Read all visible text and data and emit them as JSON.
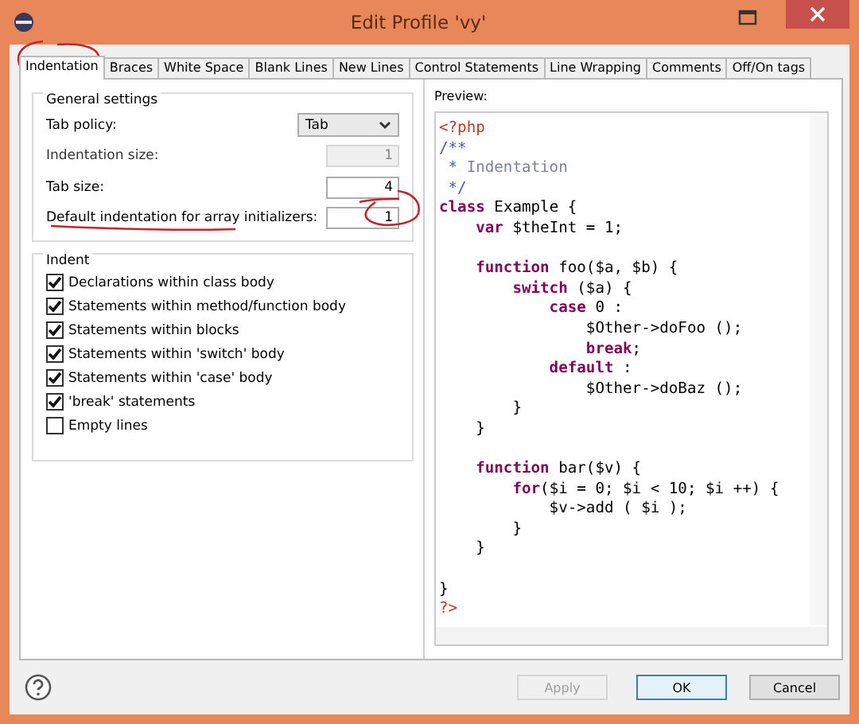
{
  "window": {
    "title": "Edit Profile 'vy'"
  },
  "tabs": [
    {
      "label": "Indentation",
      "selected": true
    },
    {
      "label": "Braces",
      "selected": false
    },
    {
      "label": "White Space",
      "selected": false
    },
    {
      "label": "Blank Lines",
      "selected": false
    },
    {
      "label": "New Lines",
      "selected": false
    },
    {
      "label": "Control Statements",
      "selected": false
    },
    {
      "label": "Line Wrapping",
      "selected": false
    },
    {
      "label": "Comments",
      "selected": false
    },
    {
      "label": "Off/On tags",
      "selected": false
    }
  ],
  "general_settings": {
    "title": "General settings",
    "fields": [
      {
        "kind": "dropdown",
        "label": "Tab policy:",
        "value": "Tab",
        "disabled": false
      },
      {
        "kind": "number",
        "label": "Indentation size:",
        "value": "1",
        "disabled": true
      },
      {
        "kind": "number",
        "label": "Tab size:",
        "value": "4",
        "disabled": false
      },
      {
        "kind": "number",
        "label": "Default indentation for array initializers:",
        "value": "1",
        "disabled": false
      }
    ]
  },
  "indent": {
    "title": "Indent",
    "options": [
      {
        "label": "Declarations within class body",
        "checked": true
      },
      {
        "label": "Statements within method/function body",
        "checked": true
      },
      {
        "label": "Statements within blocks",
        "checked": true
      },
      {
        "label": "Statements within 'switch' body",
        "checked": true
      },
      {
        "label": "Statements within 'case' body",
        "checked": true
      },
      {
        "label": "'break' statements",
        "checked": true
      },
      {
        "label": "Empty lines",
        "checked": false
      }
    ]
  },
  "preview": {
    "label": "Preview:",
    "lines": [
      {
        "kind": "code",
        "tokens": [
          {
            "kind": "tag",
            "text": "<?php"
          }
        ]
      },
      {
        "kind": "code",
        "tokens": [
          {
            "kind": "comment",
            "text": "/**"
          }
        ]
      },
      {
        "kind": "code",
        "tokens": [
          {
            "kind": "comment",
            "text": " * "
          },
          {
            "kind": "doc",
            "text": "Indentation"
          }
        ]
      },
      {
        "kind": "code",
        "tokens": [
          {
            "kind": "comment",
            "text": " */"
          }
        ]
      },
      {
        "kind": "code",
        "tokens": [
          {
            "kind": "keyword",
            "text": "class"
          },
          {
            "kind": "plain",
            "text": " Example {"
          }
        ]
      },
      {
        "kind": "code",
        "tokens": [
          {
            "kind": "keyword",
            "text": "    var"
          },
          {
            "kind": "plain",
            "text": " $theInt = 1;"
          }
        ]
      },
      {
        "kind": "blank"
      },
      {
        "kind": "code",
        "tokens": [
          {
            "kind": "keyword",
            "text": "    function"
          },
          {
            "kind": "plain",
            "text": " foo($a, $b) {"
          }
        ]
      },
      {
        "kind": "code",
        "tokens": [
          {
            "kind": "keyword",
            "text": "        switch"
          },
          {
            "kind": "plain",
            "text": " ($a) {"
          }
        ]
      },
      {
        "kind": "code",
        "tokens": [
          {
            "kind": "keyword",
            "text": "            case"
          },
          {
            "kind": "plain",
            "text": " 0 :"
          }
        ]
      },
      {
        "kind": "code",
        "tokens": [
          {
            "kind": "plain",
            "text": "                $Other->doFoo ();"
          }
        ]
      },
      {
        "kind": "code",
        "tokens": [
          {
            "kind": "keyword",
            "text": "                break"
          },
          {
            "kind": "plain",
            "text": ";"
          }
        ]
      },
      {
        "kind": "code",
        "tokens": [
          {
            "kind": "keyword",
            "text": "            default"
          },
          {
            "kind": "plain",
            "text": " :"
          }
        ]
      },
      {
        "kind": "code",
        "tokens": [
          {
            "kind": "plain",
            "text": "                $Other->doBaz ();"
          }
        ]
      },
      {
        "kind": "code",
        "tokens": [
          {
            "kind": "plain",
            "text": "        }"
          }
        ]
      },
      {
        "kind": "code",
        "tokens": [
          {
            "kind": "plain",
            "text": "    }"
          }
        ]
      },
      {
        "kind": "blank"
      },
      {
        "kind": "code",
        "tokens": [
          {
            "kind": "keyword",
            "text": "    function"
          },
          {
            "kind": "plain",
            "text": " bar($v) {"
          }
        ]
      },
      {
        "kind": "code",
        "tokens": [
          {
            "kind": "keyword",
            "text": "        for"
          },
          {
            "kind": "plain",
            "text": "($i = 0; $i < 10; $i ++) {"
          }
        ]
      },
      {
        "kind": "code",
        "tokens": [
          {
            "kind": "plain",
            "text": "            $v->add ( $i );"
          }
        ]
      },
      {
        "kind": "code",
        "tokens": [
          {
            "kind": "plain",
            "text": "        }"
          }
        ]
      },
      {
        "kind": "code",
        "tokens": [
          {
            "kind": "plain",
            "text": "    }"
          }
        ]
      },
      {
        "kind": "blank"
      },
      {
        "kind": "code",
        "tokens": [
          {
            "kind": "plain",
            "text": "}"
          }
        ]
      },
      {
        "kind": "code",
        "tokens": [
          {
            "kind": "tag",
            "text": "?>"
          }
        ]
      }
    ]
  },
  "buttons": [
    {
      "label": "Apply",
      "disabled": true,
      "default": false
    },
    {
      "label": "OK",
      "disabled": false,
      "default": true
    },
    {
      "label": "Cancel",
      "disabled": false,
      "default": false
    }
  ]
}
